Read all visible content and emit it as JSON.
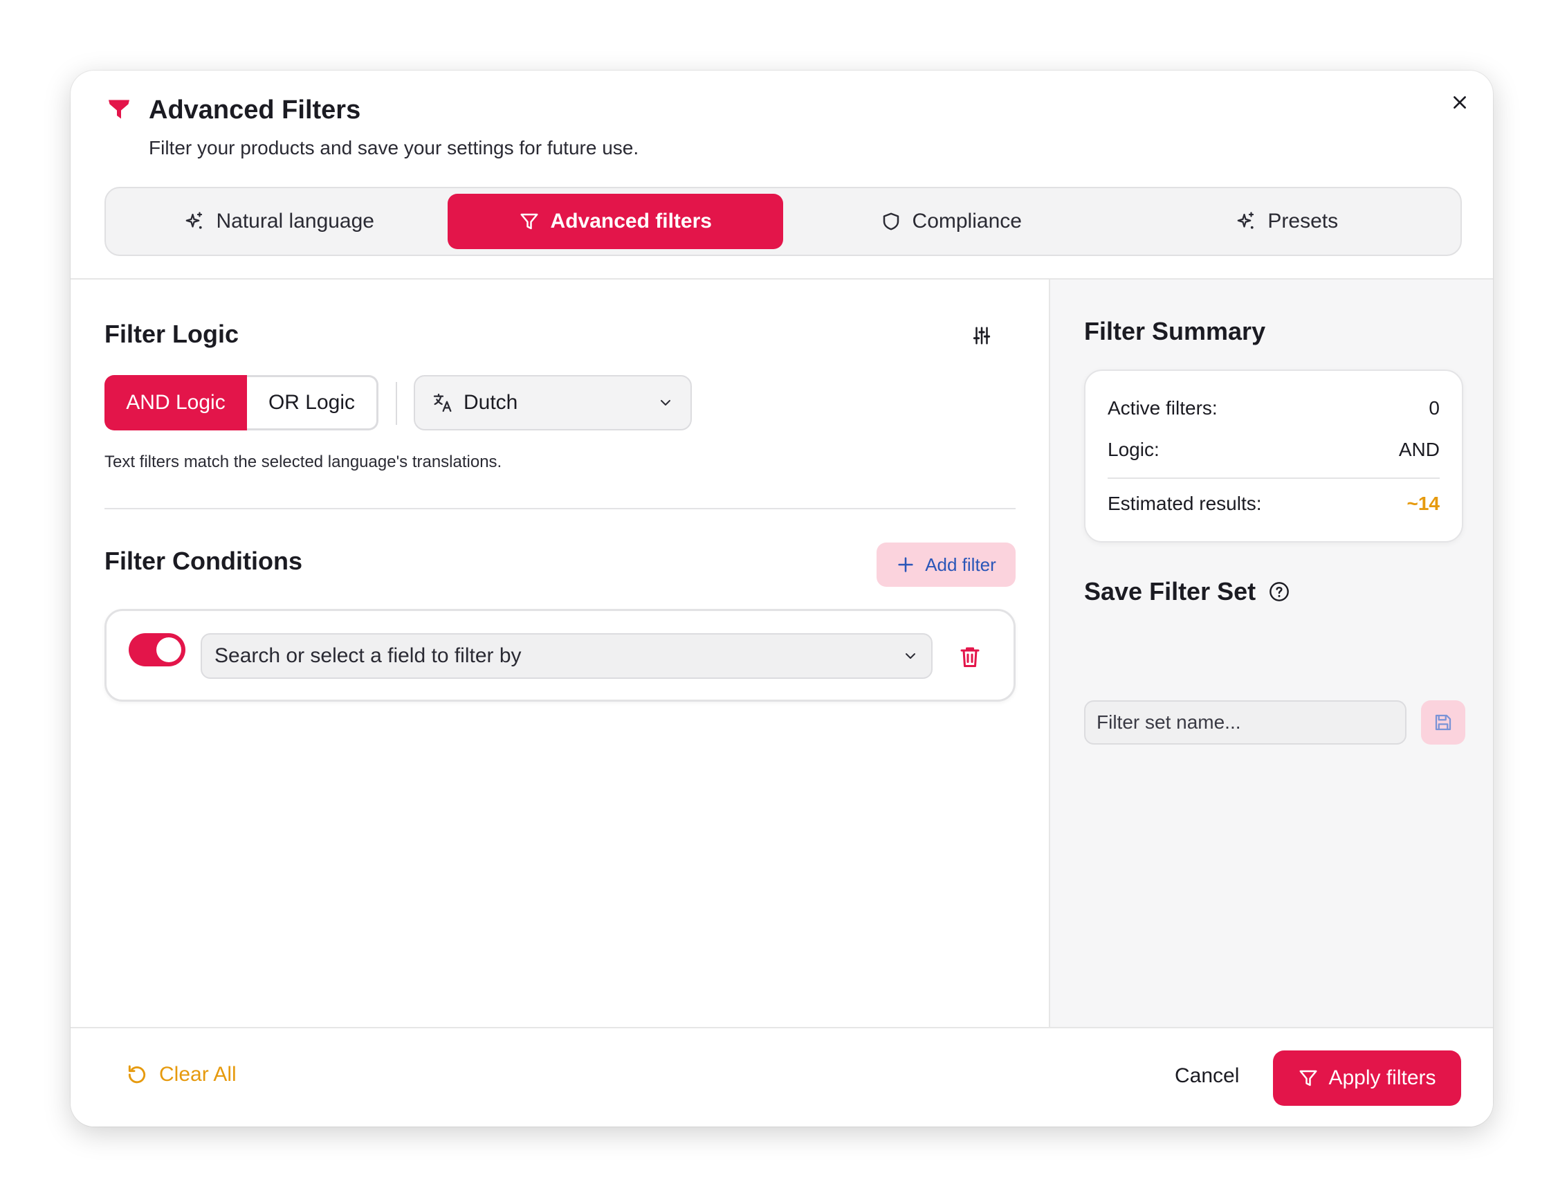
{
  "dialog": {
    "title": "Advanced Filters",
    "subtitle": "Filter your products and save your settings for future use.",
    "brand_icon": "funnel-icon",
    "close_icon": "close-icon",
    "accent_color": "#e3154a"
  },
  "tabs": [
    {
      "label": "Natural language",
      "icon": "sparkles-icon",
      "active": false
    },
    {
      "label": "Advanced filters",
      "icon": "funnel-icon",
      "active": true
    },
    {
      "label": "Compliance",
      "icon": "shield-icon",
      "active": false
    },
    {
      "label": "Presets",
      "icon": "sparkles-icon",
      "active": false
    }
  ],
  "filter_logic": {
    "title": "Filter Logic",
    "and_label": "AND Logic",
    "or_label": "OR Logic",
    "selected": "AND",
    "language": "Dutch",
    "hint": "Text filters match the selected language's translations."
  },
  "conditions": {
    "title": "Filter Conditions",
    "add_label": "Add filter",
    "rows": [
      {
        "enabled": true,
        "field_placeholder": "Search or select a field to filter by"
      }
    ]
  },
  "summary": {
    "title": "Filter Summary",
    "active_label": "Active filters:",
    "active_value": "0",
    "logic_label": "Logic:",
    "logic_value": "AND",
    "est_label": "Estimated results:",
    "est_value": "~14",
    "est_color": "#e69a0e"
  },
  "save": {
    "title": "Save Filter Set",
    "placeholder": "Filter set name..."
  },
  "footer": {
    "clear_label": "Clear All",
    "cancel_label": "Cancel",
    "apply_label": "Apply filters"
  }
}
